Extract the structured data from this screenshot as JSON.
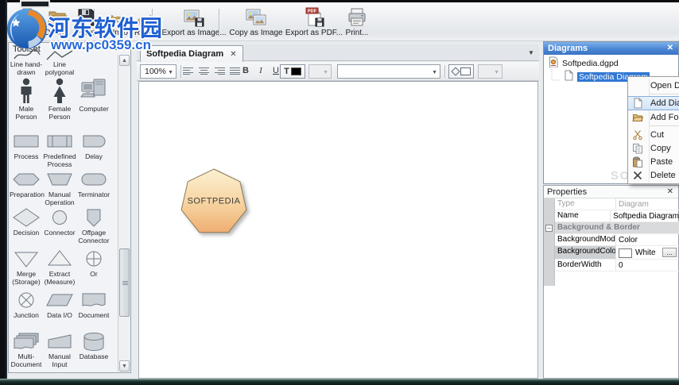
{
  "watermark": {
    "site_name": "河东软件园",
    "site_url": "www.pc0359.cn"
  },
  "toolbar": {
    "buttons": [
      {
        "label": "New",
        "icon": "new"
      },
      {
        "label": "Open...",
        "icon": "open"
      },
      {
        "label": "Save",
        "icon": "save"
      },
      {
        "label": "Undo",
        "icon": "undo"
      },
      {
        "label": "Redo",
        "icon": "redo"
      },
      {
        "label": "Export as Image...",
        "icon": "export-image"
      },
      {
        "label": "Copy as Image",
        "icon": "copy-image"
      },
      {
        "label": "Export as PDF...",
        "icon": "export-pdf"
      },
      {
        "label": "Print...",
        "icon": "print"
      }
    ]
  },
  "toolset": {
    "title": "Toolset",
    "items": [
      {
        "label": "Line hand-\ndrawn",
        "icon": "line-hand"
      },
      {
        "label": "Line\npolygonal",
        "icon": "line-poly"
      },
      {
        "label": "",
        "icon": ""
      },
      {
        "label": "Male\nPerson",
        "icon": "male"
      },
      {
        "label": "Female\nPerson",
        "icon": "female"
      },
      {
        "label": "Computer",
        "icon": "computer"
      },
      {
        "label": "Process",
        "icon": "process"
      },
      {
        "label": "Predefined\nProcess",
        "icon": "predefined"
      },
      {
        "label": "Delay",
        "icon": "delay"
      },
      {
        "label": "Preparation",
        "icon": "preparation"
      },
      {
        "label": "Manual\nOperation",
        "icon": "manual-op"
      },
      {
        "label": "Terminator",
        "icon": "terminator"
      },
      {
        "label": "Decision",
        "icon": "decision"
      },
      {
        "label": "Connector",
        "icon": "connector"
      },
      {
        "label": "Offpage\nConnector",
        "icon": "offpage"
      },
      {
        "label": "Merge\n(Storage)",
        "icon": "merge"
      },
      {
        "label": "Extract\n(Measure)",
        "icon": "extract"
      },
      {
        "label": "Or",
        "icon": "or"
      },
      {
        "label": "Junction",
        "icon": "junction"
      },
      {
        "label": "Data I/O",
        "icon": "dataio"
      },
      {
        "label": "Document",
        "icon": "document"
      },
      {
        "label": "Multi-\nDocument",
        "icon": "multidoc"
      },
      {
        "label": "Manual\nInput",
        "icon": "manualinput"
      },
      {
        "label": "Database",
        "icon": "database"
      }
    ]
  },
  "canvas": {
    "tab_title": "Softpedia Diagram",
    "zoom_value": "100%",
    "bold_label": "B",
    "italic_label": "I",
    "underline_label": "U",
    "font_color_glyph": "T",
    "font_color_value": "#000000",
    "fill_color_value": "#ffffff",
    "shape": {
      "label": "SOFTPEDIA",
      "fill_top": "#fceccb",
      "fill_bottom": "#eda869"
    }
  },
  "diagrams_panel": {
    "title": "Diagrams",
    "root_item": "Softpedia.dgpd",
    "child_item": "Softpedia Diagram",
    "ghost_watermark": "SOFTPEDIA",
    "selection_color": "#3077d4"
  },
  "context_menu": {
    "items": [
      {
        "label": "Open Diagram",
        "icon": ""
      },
      {
        "type": "sep"
      },
      {
        "label": "Add Diagram",
        "icon": "page",
        "highlighted": true
      },
      {
        "label": "Add Folder",
        "icon": "folder"
      },
      {
        "type": "sep"
      },
      {
        "label": "Cut",
        "icon": "scissors"
      },
      {
        "label": "Copy",
        "icon": "copy"
      },
      {
        "label": "Paste",
        "icon": "paste"
      },
      {
        "label": "Delete",
        "icon": "delete"
      }
    ]
  },
  "properties_panel": {
    "title": "Properties",
    "rows": [
      {
        "label": "Type",
        "value": "Diagram",
        "muted": true
      },
      {
        "label": "Name",
        "value": "Softpedia Diagram"
      },
      {
        "type": "section",
        "label": "Background & Border",
        "expander": "−"
      },
      {
        "label": "BackgroundMod",
        "value": "Color"
      },
      {
        "label": "BackgroundColo",
        "value": "White",
        "swatch": "#ffffff",
        "button_label": "...",
        "selected": true
      },
      {
        "label": "BorderWidth",
        "value": "0"
      }
    ]
  }
}
